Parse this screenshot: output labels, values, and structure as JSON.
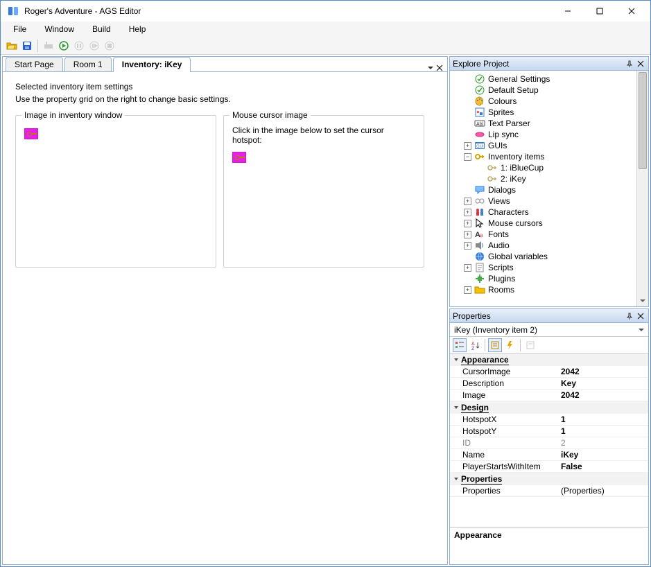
{
  "window_title": "Roger's Adventure - AGS Editor",
  "menus": [
    "File",
    "Window",
    "Build",
    "Help"
  ],
  "tabs": [
    {
      "label": "Start Page",
      "active": false
    },
    {
      "label": "Room 1",
      "active": false
    },
    {
      "label": "Inventory: iKey",
      "active": true
    }
  ],
  "content": {
    "heading": "Selected inventory item settings",
    "subheading": "Use the property grid on the right to change basic settings.",
    "box1_legend": "Image in inventory window",
    "box2_legend": "Mouse cursor image",
    "box2_hint": "Click in the image below to set the cursor hotspot:"
  },
  "explorer": {
    "title": "Explore Project",
    "items": [
      {
        "label": "General Settings",
        "icon": "check",
        "level": 1,
        "exp": null
      },
      {
        "label": "Default Setup",
        "icon": "check",
        "level": 1,
        "exp": null
      },
      {
        "label": "Colours",
        "icon": "palette",
        "level": 1,
        "exp": null
      },
      {
        "label": "Sprites",
        "icon": "sprite",
        "level": 1,
        "exp": null
      },
      {
        "label": "Text Parser",
        "icon": "abi",
        "level": 1,
        "exp": null
      },
      {
        "label": "Lip sync",
        "icon": "lips",
        "level": 1,
        "exp": null
      },
      {
        "label": "GUIs",
        "icon": "gui",
        "level": 1,
        "exp": "+"
      },
      {
        "label": "Inventory items",
        "icon": "key",
        "level": 1,
        "exp": "-"
      },
      {
        "label": "1: iBlueCup",
        "icon": "keygrey",
        "level": 2,
        "exp": null
      },
      {
        "label": "2: iKey",
        "icon": "keygrey",
        "level": 2,
        "exp": null
      },
      {
        "label": "Dialogs",
        "icon": "dialog",
        "level": 1,
        "exp": null
      },
      {
        "label": "Views",
        "icon": "views",
        "level": 1,
        "exp": "+"
      },
      {
        "label": "Characters",
        "icon": "chars",
        "level": 1,
        "exp": "+"
      },
      {
        "label": "Mouse cursors",
        "icon": "cursor",
        "level": 1,
        "exp": "+"
      },
      {
        "label": "Fonts",
        "icon": "font",
        "level": 1,
        "exp": "+"
      },
      {
        "label": "Audio",
        "icon": "audio",
        "level": 1,
        "exp": "+"
      },
      {
        "label": "Global variables",
        "icon": "globe",
        "level": 1,
        "exp": null
      },
      {
        "label": "Scripts",
        "icon": "script",
        "level": 1,
        "exp": "+"
      },
      {
        "label": "Plugins",
        "icon": "plugin",
        "level": 1,
        "exp": null
      },
      {
        "label": "Rooms",
        "icon": "room",
        "level": 1,
        "exp": "+"
      }
    ]
  },
  "properties": {
    "title": "Properties",
    "object": "iKey (Inventory item 2)",
    "categories": [
      {
        "name": "Appearance",
        "rows": [
          {
            "k": "CursorImage",
            "v": "2042"
          },
          {
            "k": "Description",
            "v": "Key"
          },
          {
            "k": "Image",
            "v": "2042"
          }
        ]
      },
      {
        "name": "Design",
        "rows": [
          {
            "k": "HotspotX",
            "v": "1"
          },
          {
            "k": "HotspotY",
            "v": "1"
          },
          {
            "k": "ID",
            "v": "2",
            "ro": true
          },
          {
            "k": "Name",
            "v": "iKey"
          },
          {
            "k": "PlayerStartsWithItem",
            "v": "False"
          }
        ]
      },
      {
        "name": "Properties",
        "rows": [
          {
            "k": "Properties",
            "v": "(Properties)",
            "paren": true
          }
        ]
      }
    ],
    "desc_title": "Appearance"
  }
}
